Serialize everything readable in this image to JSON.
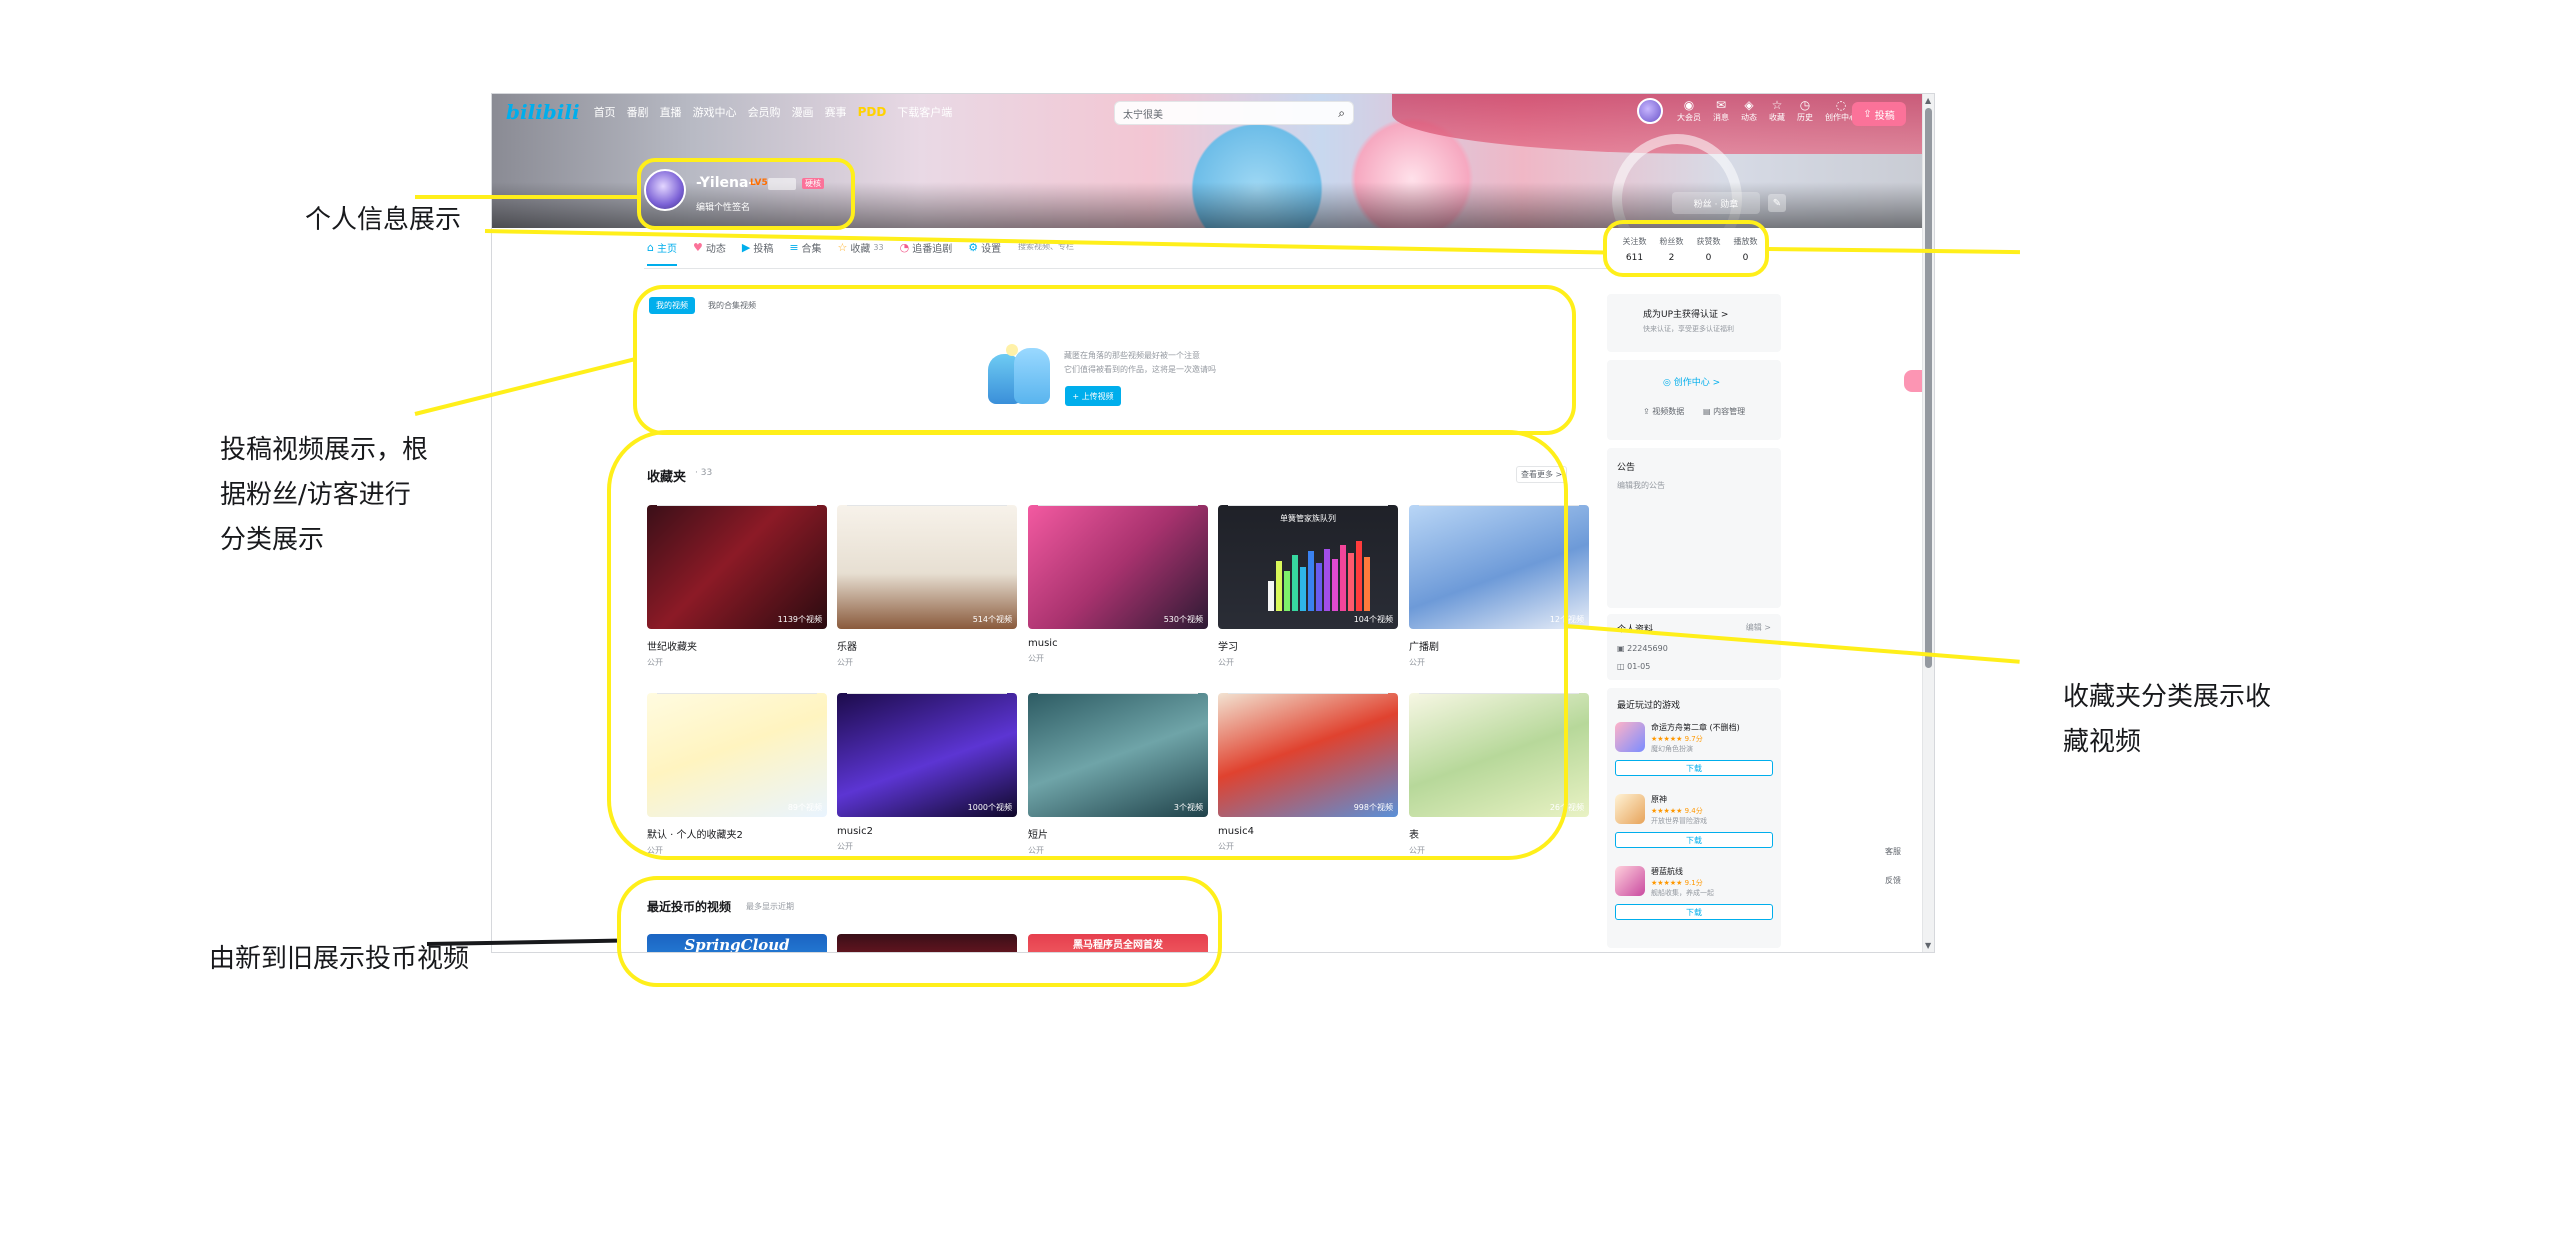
{
  "nav": {
    "logo": "bilibili",
    "items": [
      "首页",
      "番剧",
      "直播",
      "游戏中心",
      "会员购",
      "漫画",
      "赛事",
      "PDD",
      "下载客户端"
    ],
    "search_placeholder": "太宁很美",
    "right_items": [
      "大会员",
      "消息",
      "动态",
      "收藏",
      "历史",
      "创作中心"
    ],
    "upload_label": "投稿"
  },
  "profile": {
    "name": "-Yilena-",
    "level": "LV5",
    "badge": "硬核",
    "sign": "编辑个性签名",
    "follow_label": "粉丝 · 勋章"
  },
  "tabs": [
    {
      "icon": "⌂",
      "label": "主页",
      "count": ""
    },
    {
      "icon": "♥",
      "label": "动态",
      "count": ""
    },
    {
      "icon": "▶",
      "label": "投稿",
      "count": ""
    },
    {
      "icon": "≡",
      "label": "合集",
      "count": ""
    },
    {
      "icon": "☆",
      "label": "收藏",
      "count": "33"
    },
    {
      "icon": "◔",
      "label": "追番追剧",
      "count": ""
    },
    {
      "icon": "⚙",
      "label": "设置",
      "count": ""
    }
  ],
  "tab_search_placeholder": "搜索视频、专栏",
  "stats": [
    {
      "label": "关注数",
      "value": "611"
    },
    {
      "label": "粉丝数",
      "value": "2"
    },
    {
      "label": "获赞数",
      "value": "0"
    },
    {
      "label": "播放数",
      "value": "0"
    }
  ],
  "uploads": {
    "filters": [
      "我的视频",
      "我的合集视频"
    ],
    "empty_line1": "藏匿在角落的那些视频最好被一个注意",
    "empty_line2": "它们值得被看到的作品，这将是一次邀请吗",
    "button": "+ 上传视频"
  },
  "favorites": {
    "title": "收藏夹",
    "count": "· 33",
    "more": "查看更多 >",
    "items": [
      {
        "title": "世纪收藏夹",
        "count": "1139个视频",
        "privacy": "公开"
      },
      {
        "title": "乐器",
        "count": "514个视频",
        "privacy": "公开"
      },
      {
        "title": "music",
        "count": "530个视频",
        "privacy": "公开"
      },
      {
        "title": "学习",
        "count": "104个视频",
        "privacy": "公开"
      },
      {
        "title": "广播剧",
        "count": "12个视频",
        "privacy": "公开"
      },
      {
        "title": "默认 · 个人的收藏夹2",
        "count": "89个视频",
        "privacy": "公开"
      },
      {
        "title": "music2",
        "count": "1000个视频",
        "privacy": "公开"
      },
      {
        "title": "短片",
        "count": "3个视频",
        "privacy": "公开"
      },
      {
        "title": "music4",
        "count": "998个视频",
        "privacy": "公开"
      },
      {
        "title": "表",
        "count": "26个视频",
        "privacy": "公开"
      }
    ]
  },
  "chart_cover_title": "单簧管家族队列",
  "recent_coins": {
    "title": "最近投币的视频",
    "sub": "最多显示近期",
    "covers": [
      "SpringCloud",
      "",
      "黑马程序员全网首发"
    ]
  },
  "sidebar": {
    "auth_title": "成为UP主获得认证 >",
    "auth_sub": "快来认证，享受更多认证福利",
    "creator": "创作中心 >",
    "creator_btn1": "视频数据",
    "creator_btn2": "内容管理",
    "notice_title": "公告",
    "notice_text": "编辑我的公告",
    "info_title": "个人资料",
    "info_edit": "编辑 >",
    "info_uid": "22245690",
    "info_birthday": "01-05",
    "games_title": "最近玩过的游戏",
    "games": [
      {
        "name": "命运方舟第二章 (不删档)",
        "rating": "★★★★★ 9.7分",
        "desc": "魔幻角色扮演",
        "btn": "下载"
      },
      {
        "name": "原神",
        "rating": "★★★★★ 9.4分",
        "desc": "开放世界冒险游戏",
        "btn": "下载"
      },
      {
        "name": "碧蓝航线",
        "rating": "★★★★★ 9.1分",
        "desc": "舰船收集，养成一起",
        "btn": "下载"
      }
    ]
  },
  "float_tools": [
    "客服",
    "反馈"
  ],
  "annotations": {
    "profile": "个人信息展示",
    "uploads_l1": "投稿视频展示，根",
    "uploads_l2": "据粉丝/访客进行",
    "uploads_l3": "分类展示",
    "favorites_l1": "收藏夹分类展示收",
    "favorites_l2": "藏视频",
    "coins": "由新到旧展示投币视频"
  },
  "colors": {
    "accent": "#00aeec",
    "pink": "#fb7299",
    "highlight": "#ffef1a"
  }
}
